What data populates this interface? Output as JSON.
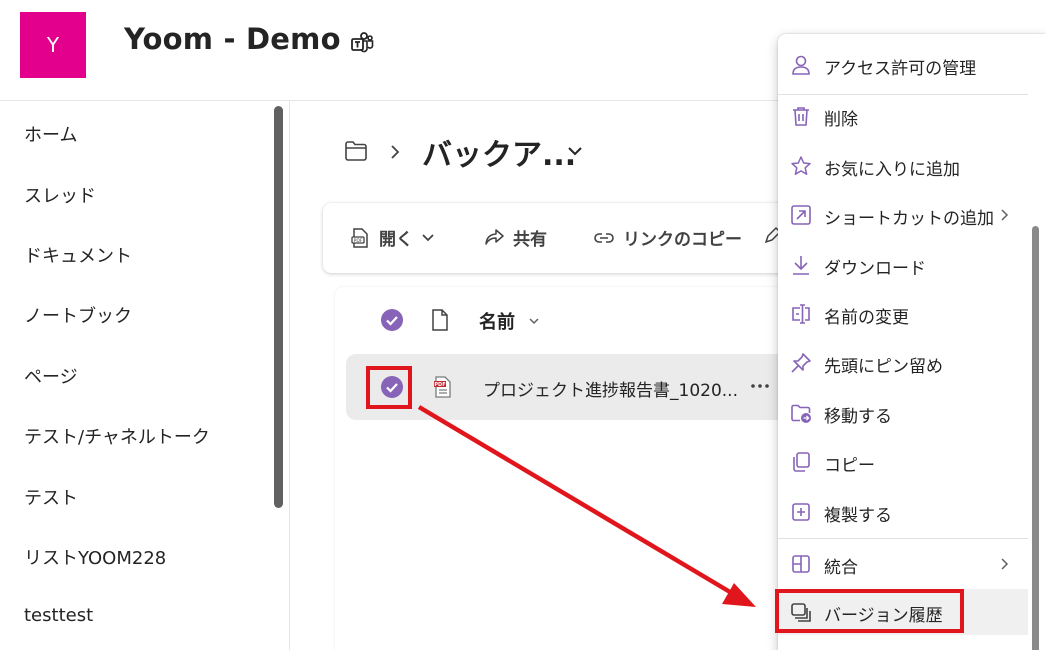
{
  "site": {
    "logo_letter": "Y",
    "title": "Yoom - Demo"
  },
  "nav": {
    "items": [
      "ホーム",
      "スレッド",
      "ドキュメント",
      "ノートブック",
      "ページ",
      "テスト/チャネルトーク",
      "テスト",
      "リストYOOM228",
      "testtest"
    ]
  },
  "breadcrumb": {
    "folder_title": "バックア..."
  },
  "commands": {
    "open": "開く",
    "share": "共有",
    "copy_link": "リンクのコピー"
  },
  "list": {
    "name_header": "名前",
    "file_name": "プロジェクト進捗報告書_1020..."
  },
  "menu": {
    "items": [
      {
        "label": "アクセス許可の管理",
        "icon": "person-icon"
      },
      {
        "label": "削除",
        "icon": "trash-icon"
      },
      {
        "label": "お気に入りに追加",
        "icon": "star-icon"
      },
      {
        "label": "ショートカットの追加",
        "icon": "shortcut-icon",
        "submenu": true
      },
      {
        "label": "ダウンロード",
        "icon": "download-icon"
      },
      {
        "label": "名前の変更",
        "icon": "rename-icon"
      },
      {
        "label": "先頭にピン留め",
        "icon": "pin-icon"
      },
      {
        "label": "移動する",
        "icon": "move-folder-icon"
      },
      {
        "label": "コピー",
        "icon": "copy-icon"
      },
      {
        "label": "複製する",
        "icon": "duplicate-icon"
      },
      {
        "label": "統合",
        "icon": "integrate-icon",
        "submenu": true
      },
      {
        "label": "バージョン履歴",
        "icon": "version-history-icon",
        "highlighted": true
      }
    ]
  },
  "colors": {
    "logo_bg": "#e3008c",
    "accent_purple": "#8764b8",
    "annotation_red": "#e0161c"
  }
}
